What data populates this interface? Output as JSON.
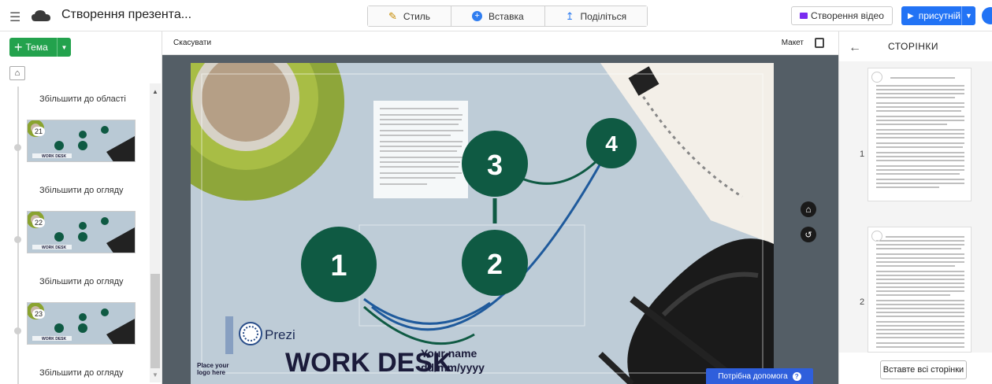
{
  "header": {
    "title": "Створення презента...",
    "style_label": "Стиль",
    "insert_label": "Вставка",
    "share_label": "Поділіться",
    "video_label": "Створення відео",
    "present_label": "присутній"
  },
  "sidebar": {
    "topic_label": "Тема",
    "items": [
      {
        "label": "Збільшити до області"
      },
      {
        "label": "Збільшити до огляду",
        "number": "21"
      },
      {
        "label": "Збільшити до огляду",
        "number": "22"
      },
      {
        "label": "Збільшити до огляду",
        "number": "23"
      }
    ]
  },
  "canvas": {
    "cancel_label": "Скасувати",
    "layout_label": "Макет",
    "steps": [
      "1",
      "2",
      "3",
      "4"
    ],
    "brand": "Prezi",
    "place_logo": "Place your logo here",
    "headline": "WORK DESK",
    "your_name": "Your name",
    "date_placeholder": "dd/mm/yyyy",
    "help_label": "Потрібна допомога",
    "thumb_headline": "WORK DESK"
  },
  "pages_panel": {
    "title": "СТОРІНКИ",
    "pages": [
      "1",
      "2"
    ],
    "insert_all_label": "Вставте всі сторінки"
  },
  "colors": {
    "accent_green": "#23a24d",
    "circle_green": "#0f5a43",
    "present_blue": "#2273f5",
    "help_blue": "#2f5fdc",
    "video_purple": "#7a2cf0"
  }
}
